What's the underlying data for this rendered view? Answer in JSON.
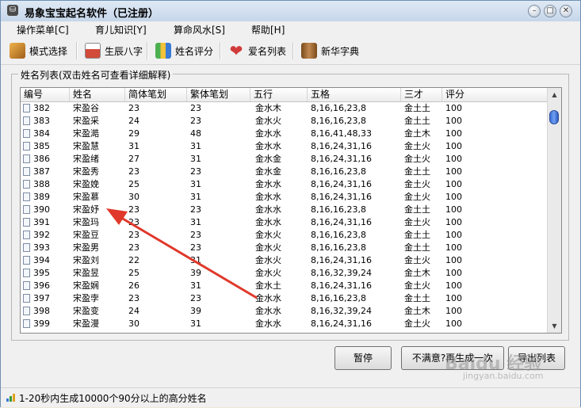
{
  "window": {
    "title": "易象宝宝起名软件（已注册）",
    "app_icon_glyph": "⛁"
  },
  "menu": [
    {
      "label": "操作菜单[C]"
    },
    {
      "label": "育儿知识[Y]"
    },
    {
      "label": "算命风水[S]"
    },
    {
      "label": "帮助[H]"
    }
  ],
  "toolbar": [
    {
      "label": "模式选择",
      "icon": "book-icon",
      "color": "#c97b1f"
    },
    {
      "label": "生辰八字",
      "icon": "calendar-icon",
      "color": "#b23a2a"
    },
    {
      "label": "姓名评分",
      "icon": "blocks-icon",
      "color": "#3c9a3c"
    },
    {
      "label": "爱名列表",
      "icon": "heart-icon",
      "color": "#d23a3a"
    },
    {
      "label": "新华字典",
      "icon": "dictionary-icon",
      "color": "#8a5a2a"
    }
  ],
  "group_title": "姓名列表(双击姓名可查看详细解释)",
  "columns": [
    "编号",
    "姓名",
    "简体笔划",
    "繁体笔划",
    "五行",
    "五格",
    "三才",
    "评分"
  ],
  "rows": [
    [
      "382",
      "宋盈谷",
      "23",
      "23",
      "金水木",
      "8,16,16,23,8",
      "金土土",
      "100"
    ],
    [
      "383",
      "宋盈采",
      "24",
      "23",
      "金水火",
      "8,16,16,23,8",
      "金土土",
      "100"
    ],
    [
      "384",
      "宋盈澔",
      "29",
      "48",
      "金水水",
      "8,16,41,48,33",
      "金土木",
      "100"
    ],
    [
      "385",
      "宋盈慧",
      "31",
      "31",
      "金水水",
      "8,16,24,31,16",
      "金土火",
      "100"
    ],
    [
      "386",
      "宋盈绪",
      "27",
      "31",
      "金水金",
      "8,16,24,31,16",
      "金土火",
      "100"
    ],
    [
      "387",
      "宋盈秀",
      "23",
      "23",
      "金水金",
      "8,16,16,23,8",
      "金土土",
      "100"
    ],
    [
      "388",
      "宋盈娩",
      "25",
      "31",
      "金水水",
      "8,16,24,31,16",
      "金土火",
      "100"
    ],
    [
      "389",
      "宋盈慕",
      "30",
      "31",
      "金水水",
      "8,16,24,31,16",
      "金土火",
      "100"
    ],
    [
      "390",
      "宋盈妤",
      "23",
      "23",
      "金水水",
      "8,16,16,23,8",
      "金土土",
      "100"
    ],
    [
      "391",
      "宋盈玛",
      "23",
      "31",
      "金水水",
      "8,16,24,31,16",
      "金土火",
      "100"
    ],
    [
      "392",
      "宋盈豆",
      "23",
      "23",
      "金水火",
      "8,16,16,23,8",
      "金土土",
      "100"
    ],
    [
      "393",
      "宋盈男",
      "23",
      "23",
      "金水火",
      "8,16,16,23,8",
      "金土土",
      "100"
    ],
    [
      "394",
      "宋盈刘",
      "22",
      "31",
      "金水火",
      "8,16,24,31,16",
      "金土火",
      "100"
    ],
    [
      "395",
      "宋盈昱",
      "25",
      "39",
      "金水火",
      "8,16,32,39,24",
      "金土木",
      "100"
    ],
    [
      "396",
      "宋盈娴",
      "26",
      "31",
      "金水土",
      "8,16,24,31,16",
      "金土火",
      "100"
    ],
    [
      "397",
      "宋盈孛",
      "23",
      "23",
      "金水水",
      "8,16,16,23,8",
      "金土土",
      "100"
    ],
    [
      "398",
      "宋盈变",
      "24",
      "39",
      "金水水",
      "8,16,32,39,24",
      "金土木",
      "100"
    ],
    [
      "399",
      "宋盈漫",
      "30",
      "31",
      "金水水",
      "8,16,24,31,16",
      "金土火",
      "100"
    ]
  ],
  "buttons": {
    "pause": "暂停",
    "regenerate": "不满意?再生成一次",
    "export": "导出列表"
  },
  "status": "1-20秒内生成10000个90分以上的高分姓名",
  "watermark": {
    "main": "Baidu 经验",
    "sub": "jingyan.baidu.com"
  },
  "annotation": {
    "color": "#e0392b",
    "points_to_row": "390"
  }
}
